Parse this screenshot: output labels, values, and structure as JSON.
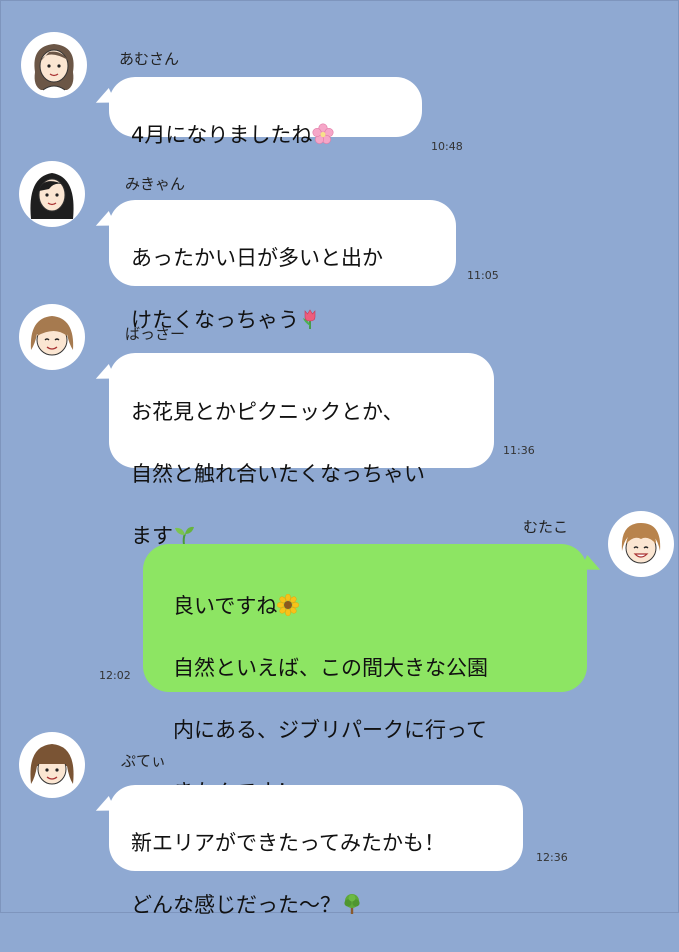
{
  "messages": [
    {
      "sender": "あむさん",
      "lines": [
        "4月になりましたね"
      ],
      "emoji": "cherry-blossom-icon",
      "time": "10:48"
    },
    {
      "sender": "みきゃん",
      "lines": [
        "あったかい日が多いと出か",
        "けたくなっちゃう"
      ],
      "emoji": "tulip-icon",
      "time": "11:05"
    },
    {
      "sender": "ばっさー",
      "lines": [
        "お花見とかピクニックとか、",
        "自然と触れ合いたくなっちゃい",
        "ます"
      ],
      "emoji": "seedling-icon",
      "time": "11:36"
    },
    {
      "sender": "むたこ",
      "lines": [
        "良いですね",
        "自然といえば、この間大きな公園",
        "内にある、ジブリパークに行って",
        "きたんです！"
      ],
      "emoji": "sunflower-icon",
      "time": "12:02"
    },
    {
      "sender": "ぷてぃ",
      "lines": [
        "新エリアができたってみたかも！",
        "どんな感じだった〜？"
      ],
      "emoji": "tree-icon",
      "time": "12:36"
    }
  ],
  "colors": {
    "background": "#8fa9d2",
    "incoming_bubble": "#ffffff",
    "outgoing_bubble": "#8de563"
  }
}
